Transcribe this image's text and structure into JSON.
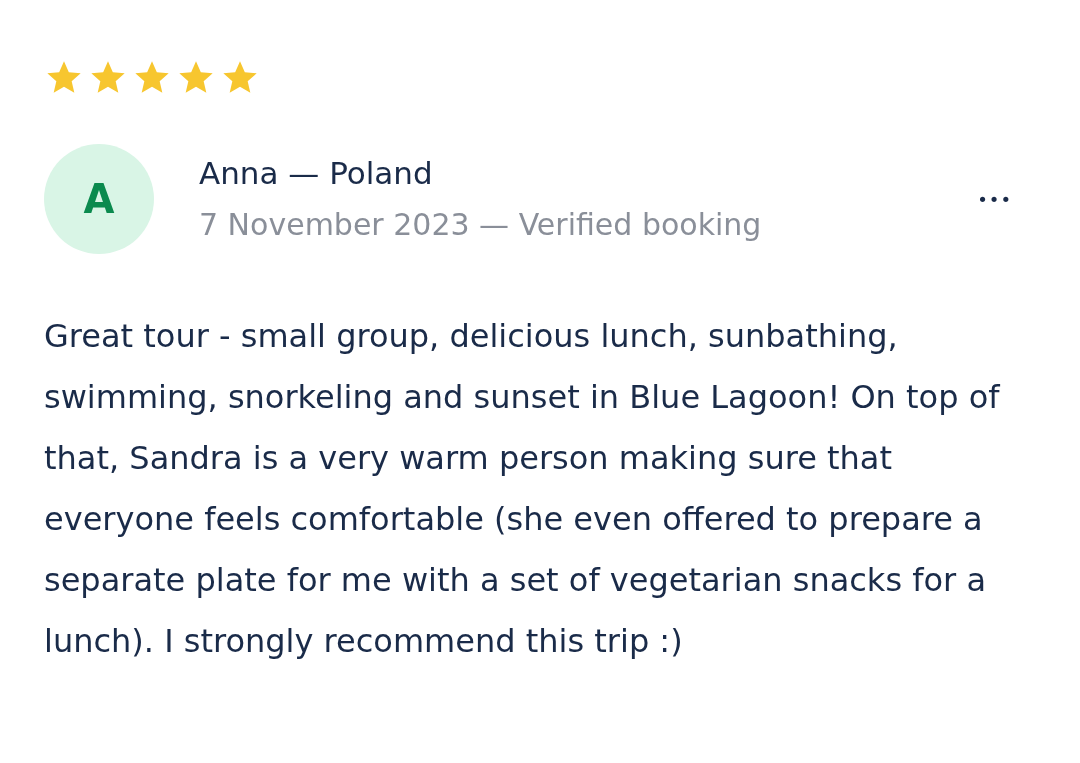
{
  "review": {
    "stars": 5,
    "avatar_initial": "A",
    "author": "Anna — Poland",
    "meta": "7 November 2023 — Verified booking",
    "more_menu": "•••",
    "text": "Great tour - small group, delicious lunch, sunbathing, swimming, snorkeling and sunset in Blue Lagoon! On top of that, Sandra is a very warm person making sure that everyone feels comfortable (she even offered to prepare a separate plate for me with a set of vegetarian snacks for a lunch). I strongly recommend this trip :)"
  }
}
